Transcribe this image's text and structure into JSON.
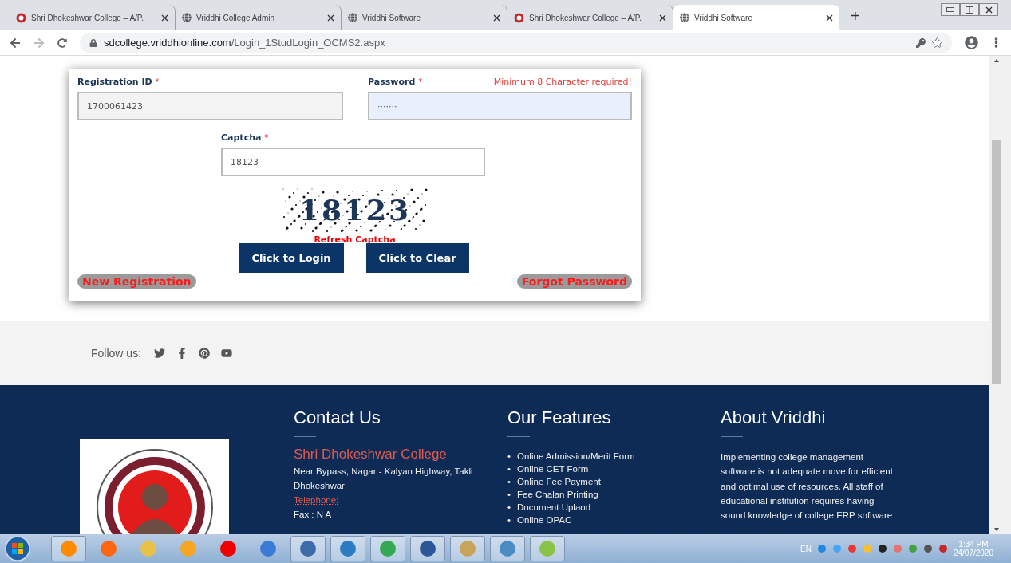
{
  "browser": {
    "tabs": [
      {
        "title": "Shri Dhokeshwar College – A/P.",
        "kind": "emblem",
        "selected": false
      },
      {
        "title": "Vriddhi College Admin",
        "kind": "globe",
        "selected": false
      },
      {
        "title": "Vriddhi Software",
        "kind": "globe",
        "selected": false
      },
      {
        "title": "Shri Dhokeshwar College – A/P.",
        "kind": "emblem",
        "selected": false
      },
      {
        "title": "Vriddhi Software",
        "kind": "globe",
        "selected": true
      }
    ],
    "new_tab": "+",
    "url_host": "sdcollege.vriddhionline.com",
    "url_path": "/Login_1StudLogin_OCMS2.aspx"
  },
  "login": {
    "registration_label": "Registration ID",
    "registration_value": "1700061423",
    "password_label": "Password",
    "password_hint": "Minimum 8 Character required!",
    "password_value": "·······",
    "captcha_label": "Captcha",
    "captcha_value": "18123",
    "required_mark": "*",
    "captcha_image_text": "18123",
    "refresh_captcha": "Refresh Captcha",
    "buttons": [
      "Click to Login",
      "Click to Clear"
    ],
    "new_registration": "New Registration",
    "forgot_password": "Forgot Password"
  },
  "follow": {
    "label": "Follow us:",
    "links": [
      {
        "kind": "twitter"
      },
      {
        "kind": "facebook"
      },
      {
        "kind": "pinterest"
      },
      {
        "kind": "youtube"
      }
    ]
  },
  "footer": {
    "contact": {
      "title": "Contact Us",
      "college": "Shri Dhokeshwar College",
      "address": "Near Bypass, Nagar - Kalyan Highway, Takli Dhokeshwar",
      "telephone": "Telephone:",
      "fax": "Fax : N A"
    },
    "features": {
      "title": "Our Features",
      "bullet": "•",
      "items": [
        "Online Admission/Merit Form",
        "Online CET Form",
        "Online Fee Payment",
        "Fee Chalan Printing",
        "Document Uplaod",
        "Online OPAC"
      ]
    },
    "about": {
      "title": "About Vriddhi",
      "text": "Implementing college management software is not adequate move for efficient and optimal use of resources. All staff of educational institution requires having sound knowledge of college ERP software"
    }
  },
  "taskbar": {
    "language": "EN",
    "time": "1:34 PM",
    "date": "24/07/2020"
  }
}
